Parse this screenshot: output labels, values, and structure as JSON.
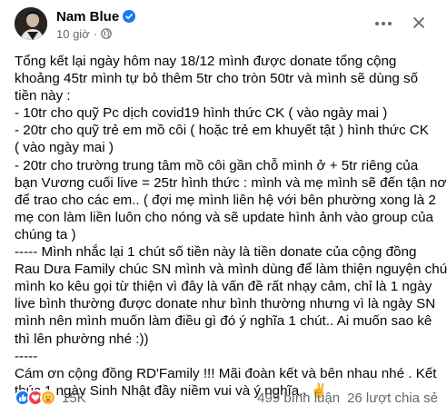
{
  "author": {
    "name": "Nam Blue"
  },
  "meta": {
    "time": "10 giờ",
    "separator": "·"
  },
  "content": {
    "lines": [
      "Tổng kết lại ngày hôm nay 18/12 mình được donate tổng cộng",
      "khoảng 45tr mình tự bỏ thêm 5tr cho tròn 50tr và mình sẽ dùng số",
      "tiền này :",
      "- 10tr cho quỹ Pc dịch covid19 hình thức CK ( vào ngày mai )",
      "- 20tr cho quỹ trẻ em mồ côi ( hoặc trẻ em khuyết tật ) hình thức CK",
      "( vào ngày mai )",
      "- 20tr cho trường trung tâm mồ côi gần chỗ mình ở + 5tr riêng của",
      "bạn Vương cuối live = 25tr hình thức : mình và mẹ mình sẽ đến tận nơi",
      "để trao cho các em.. ( đợi mẹ mình liên hệ với bên phường xong là 2",
      "mẹ con làm liền luôn cho nóng và sẽ update hình ảnh vào group của",
      "chúng ta )",
      "----- Mình nhắc lại 1 chút số tiền này là tiền donate của cộng đồng",
      "Rau Dưa Family chúc SN mình và mình dùng để làm thiện nguyện chứ",
      "mình ko kêu gọi từ thiện vì đây là vấn đề rất nhạy cảm, chỉ là 1 ngày",
      "live bình thường được donate như bình thường nhưng vì là ngày SN",
      "mình nên mình muốn làm điều gì đó ý nghĩa 1 chút.. Ai muốn sao kê",
      "thì lên phường nhé :))",
      "-----",
      "Cám ơn cộng đồng RD'Family !!! Mãi đoàn kết và bên nhau nhé . Kết",
      "thúc 1 ngày Sinh Nhật đầy niềm vui và ý nghĩa.. ✌️"
    ]
  },
  "footer": {
    "reaction_count": "15K",
    "comments": "499 bình luận",
    "shares": "26 lượt chia sẻ"
  },
  "icons": {
    "verified": "verified-badge-icon",
    "audience": "globe-icon",
    "more": "more-options-icon",
    "close": "close-icon",
    "reactions": [
      "like-icon",
      "love-icon",
      "care-icon"
    ]
  },
  "colors": {
    "accent": "#1877f2",
    "secondary_text": "#65676b",
    "love": "#f33e58",
    "care": "#f7b125"
  }
}
